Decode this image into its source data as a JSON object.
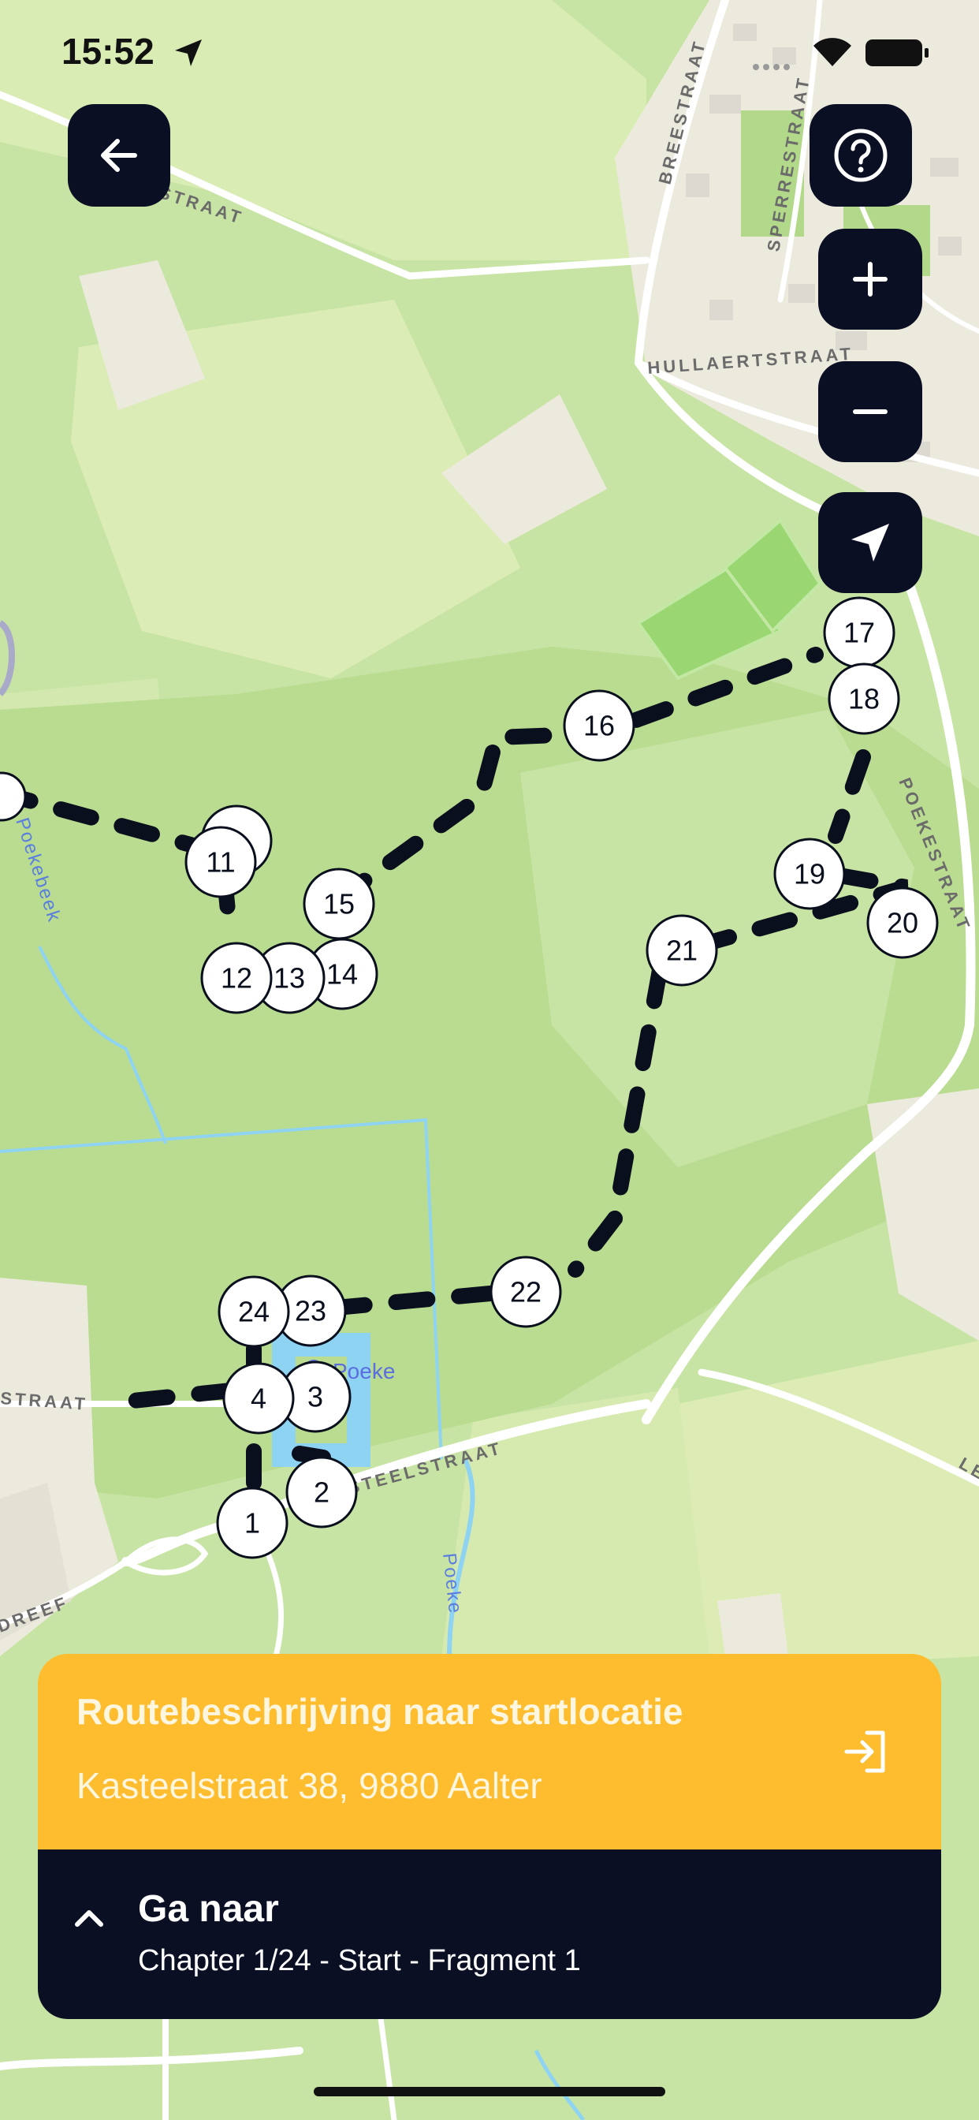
{
  "status_bar": {
    "time": "15:52"
  },
  "map": {
    "road_labels": [
      "BREESTRAAT",
      "SPERRESTRAAT",
      "HULLAERTSTRAAT",
      "POEKESTRAAT",
      "STRAAT",
      "STRAAT",
      "KASTEELSTRAAT",
      "DREEF",
      "LE"
    ],
    "water_labels": [
      "Poekebeek",
      "Poeke"
    ],
    "place_label": "Poeke",
    "markers": [
      "1",
      "2",
      "3",
      "4",
      "11",
      "12",
      "13",
      "14",
      "15",
      "16",
      "17",
      "18",
      "19",
      "20",
      "21",
      "22",
      "23",
      "24"
    ]
  },
  "controls": {
    "back": "back-arrow-icon",
    "help": "question-mark-icon",
    "zoom_in": "plus-icon",
    "zoom_out": "minus-icon",
    "locate": "navigation-arrow-icon"
  },
  "panel": {
    "title": "Routebeschrijving naar startlocatie",
    "address": "Kasteelstraat 38, 9880 Aalter",
    "goto_title": "Ga naar",
    "goto_subtitle": "Chapter 1/24 - Start - Fragment 1",
    "colors": {
      "accent": "#fdbd2e",
      "dark": "#0a0f24"
    }
  }
}
